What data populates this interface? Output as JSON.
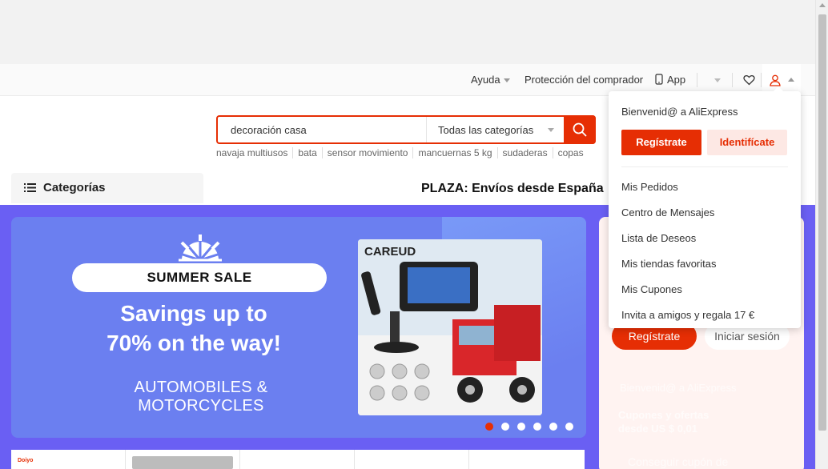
{
  "topbar": {
    "help": "Ayuda",
    "buyer_protection": "Protección del comprador",
    "app": "App"
  },
  "search": {
    "value": "decoración casa",
    "category": "Todas las categorías",
    "hotwords": [
      "navaja multiusos",
      "bata",
      "sensor movimiento",
      "mancuernas 5 kg",
      "sudaderas",
      "copas"
    ]
  },
  "categories": {
    "label": "Categorías"
  },
  "plaza": "PLAZA: Envíos desde España",
  "banner": {
    "pill": "SUMMER SALE",
    "savings_line1": "Savings up to",
    "savings_line2": "70% on the way!",
    "category": "AUTOMOBILES & MOTORCYCLES",
    "product_brand": "CAREUD",
    "slides": 6,
    "active_slide": 1
  },
  "right_panel": {
    "register": "Regístrate",
    "login": "Iniciar sesión",
    "welcome": "Bienvenid@ a AliExpress",
    "coupons": "Cupones y ofertas",
    "coupons_sub": "desde US $ 0,01",
    "coupon_cta": "Conseguir cupón de"
  },
  "dropdown": {
    "welcome": "Bienvenid@ a AliExpress",
    "register": "Regístrate",
    "login": "Identifícate",
    "items": [
      "Mis Pedidos",
      "Centro de Mensajes",
      "Lista de Deseos",
      "Mis tiendas favoritas",
      "Mis Cupones",
      "Invita a amigos y regala 17 €"
    ]
  },
  "colors": {
    "accent": "#e62e04",
    "band": "#6a5ff3",
    "banner": "#6b7ff0"
  }
}
